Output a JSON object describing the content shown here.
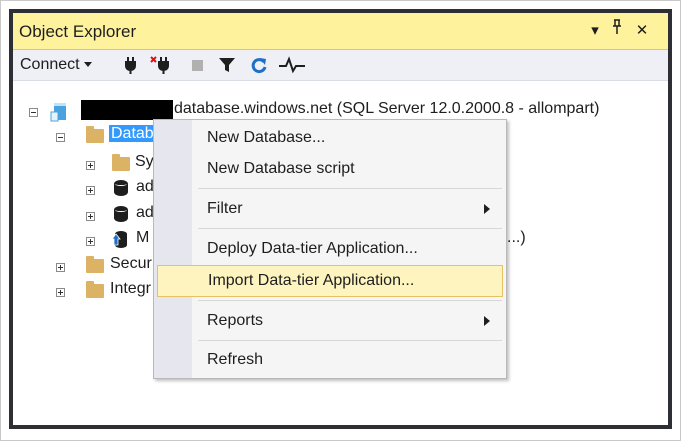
{
  "panel": {
    "title": "Object Explorer",
    "title_buttons": [
      "▾",
      "⊥",
      "✕"
    ]
  },
  "toolbar": {
    "connect_label": "Connect",
    "icons": [
      "connect-plug-icon",
      "disconnect-plug-icon",
      "stop-icon",
      "filter-icon",
      "refresh-icon",
      "activity-monitor-icon"
    ]
  },
  "tree": {
    "server_label": "database.windows.net (SQL Server 12.0.2000.8 - allompart)",
    "databases_label": "Datab",
    "sys_label": "Sy",
    "db1_label": "ad",
    "db2_label": "ad",
    "db3_label": "M",
    "db3_suffix": "...)",
    "security_label": "Secur",
    "integration_label": "Integr"
  },
  "context_menu": {
    "items": [
      {
        "label": "New Database..."
      },
      {
        "label": "New Database script"
      },
      {
        "label": "Filter",
        "submenu": true
      },
      {
        "label": "Deploy Data-tier Application..."
      },
      {
        "label": "Import Data-tier Application...",
        "highlighted": true
      },
      {
        "label": "Reports",
        "submenu": true
      },
      {
        "label": "Refresh"
      }
    ]
  },
  "colors": {
    "titlebar": "#fff29d",
    "panel_border": "#2e2f35",
    "highlight": "#fdf4bf",
    "selection": "#3399ff"
  }
}
